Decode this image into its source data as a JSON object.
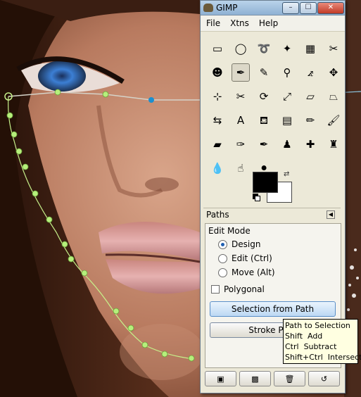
{
  "window": {
    "title": "GIMP",
    "controls": [
      "–",
      "☐",
      "✕"
    ]
  },
  "menubar": {
    "items": [
      "File",
      "Xtns",
      "Help"
    ]
  },
  "tools": [
    {
      "icon": "rect-select-icon",
      "glyph": "▭",
      "selected": false
    },
    {
      "icon": "ellipse-select-icon",
      "glyph": "◯",
      "selected": false
    },
    {
      "icon": "lasso-icon",
      "glyph": "➰",
      "selected": false
    },
    {
      "icon": "fuzzy-select-icon",
      "glyph": "✦",
      "selected": false
    },
    {
      "icon": "select-by-color-icon",
      "glyph": "▦",
      "selected": false
    },
    {
      "icon": "scissors-icon",
      "glyph": "✂",
      "selected": false
    },
    {
      "icon": "foreground-select-icon",
      "glyph": "☻",
      "selected": false
    },
    {
      "icon": "paths-tool-icon",
      "glyph": "✒",
      "selected": true
    },
    {
      "icon": "color-picker-icon",
      "glyph": "✎",
      "selected": false
    },
    {
      "icon": "zoom-icon",
      "glyph": "⚲",
      "selected": false
    },
    {
      "icon": "measure-icon",
      "glyph": "⦨",
      "selected": false
    },
    {
      "icon": "move-icon",
      "glyph": "✥",
      "selected": false
    },
    {
      "icon": "align-icon",
      "glyph": "⊹",
      "selected": false
    },
    {
      "icon": "crop-icon",
      "glyph": "✂",
      "selected": false
    },
    {
      "icon": "rotate-icon",
      "glyph": "⟳",
      "selected": false
    },
    {
      "icon": "scale-icon",
      "glyph": "⤢",
      "selected": false
    },
    {
      "icon": "shear-icon",
      "glyph": "▱",
      "selected": false
    },
    {
      "icon": "perspective-icon",
      "glyph": "⏢",
      "selected": false
    },
    {
      "icon": "flip-icon",
      "glyph": "⇆",
      "selected": false
    },
    {
      "icon": "text-icon",
      "glyph": "A",
      "selected": false
    },
    {
      "icon": "bucket-fill-icon",
      "glyph": "⛾",
      "selected": false
    },
    {
      "icon": "blend-icon",
      "glyph": "▤",
      "selected": false
    },
    {
      "icon": "pencil-icon",
      "glyph": "✏",
      "selected": false
    },
    {
      "icon": "paintbrush-icon",
      "glyph": "🖌",
      "selected": false
    },
    {
      "icon": "eraser-icon",
      "glyph": "▰",
      "selected": false
    },
    {
      "icon": "airbrush-icon",
      "glyph": "✑",
      "selected": false
    },
    {
      "icon": "ink-icon",
      "glyph": "✒",
      "selected": false
    },
    {
      "icon": "clone-icon",
      "glyph": "♟",
      "selected": false
    },
    {
      "icon": "heal-icon",
      "glyph": "✚",
      "selected": false
    },
    {
      "icon": "perspective-clone-icon",
      "glyph": "♜",
      "selected": false
    },
    {
      "icon": "blur-icon",
      "glyph": "💧",
      "selected": false
    },
    {
      "icon": "smudge-icon",
      "glyph": "☝",
      "selected": false
    },
    {
      "icon": "dodge-burn-icon",
      "glyph": "⚫",
      "selected": false
    }
  ],
  "colors": {
    "foreground": "#000000",
    "background": "#ffffff"
  },
  "paths_dock": {
    "title": "Paths",
    "edit_mode_label": "Edit Mode",
    "modes": [
      {
        "label": "Design",
        "checked": true
      },
      {
        "label": "Edit (Ctrl)",
        "checked": false
      },
      {
        "label": "Move (Alt)",
        "checked": false
      }
    ],
    "polygonal_label": "Polygonal",
    "polygonal_checked": false,
    "selection_from_path_label": "Selection from Path",
    "stroke_path_label": "Stroke Path"
  },
  "tooltip": {
    "lines": [
      "Path to Selection",
      "Shift  Add",
      "Ctrl  Subtract",
      "Shift+Ctrl  Intersect"
    ]
  },
  "bottom_buttons": [
    {
      "icon": "save-icon",
      "glyph": "▣"
    },
    {
      "icon": "pattern-icon",
      "glyph": "▩"
    },
    {
      "icon": "trash-icon",
      "glyph": "🗑"
    },
    {
      "icon": "reset-icon",
      "glyph": "↺"
    }
  ]
}
